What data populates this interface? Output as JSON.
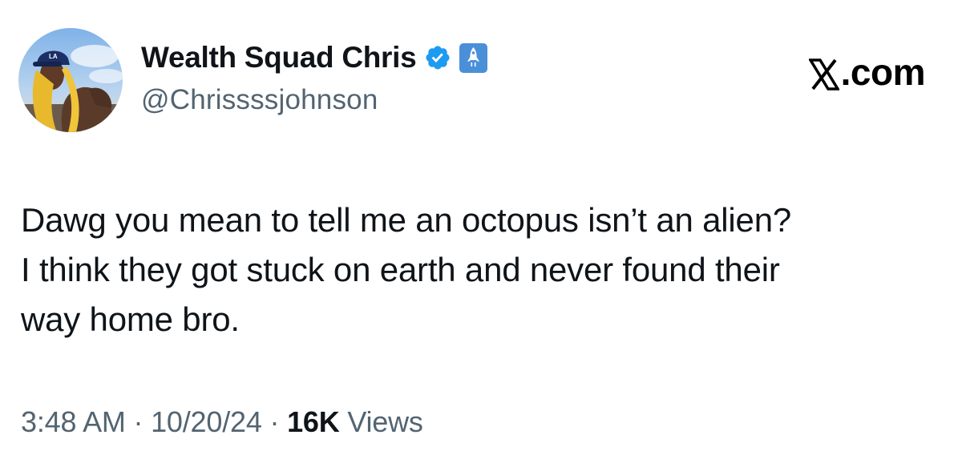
{
  "tweet": {
    "display_name": "Wealth Squad Chris",
    "handle": "@Chrissssjohnson",
    "verified_icon": "verified-badge-icon",
    "affiliate_icon": "rocket-badge-icon",
    "brand_x": "𝕏",
    "brand_suffix": ".com",
    "lines": [
      "Dawg you mean to tell me an octopus isn’t an alien?",
      "I think they got stuck on earth and never found their",
      "way home bro."
    ],
    "time": "3:48 AM",
    "separator": "·",
    "date": "10/20/24",
    "views_count": "16K",
    "views_label": "Views"
  },
  "colors": {
    "verified_blue": "#1d9bf0",
    "affiliate_blue": "#4a90d9",
    "muted_text": "#536471",
    "main_text": "#0f1419"
  }
}
